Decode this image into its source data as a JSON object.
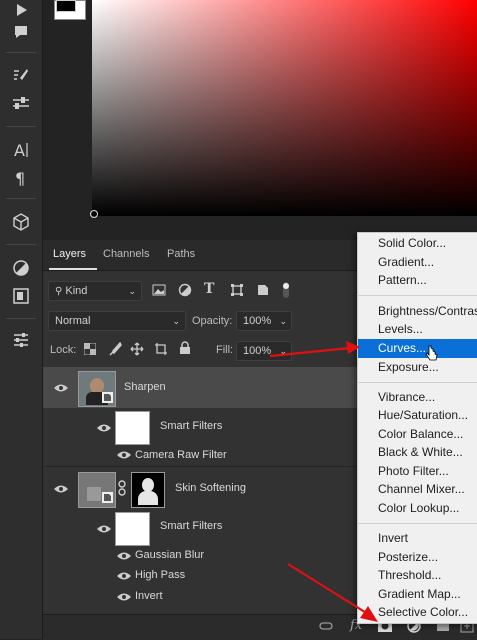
{
  "colors": {
    "accent": "#0a6fd6",
    "arrow": "#e01010"
  },
  "toolbar": {
    "icons": [
      "play-icon",
      "comment-icon",
      "brush-settings-icon",
      "sliders-icon",
      "type-icon",
      "paragraph-icon",
      "cube-icon",
      "adjustment-icon",
      "frame-icon",
      "properties-icon"
    ]
  },
  "tabs": {
    "layers": "Layers",
    "channels": "Channels",
    "paths": "Paths"
  },
  "filter": {
    "kind": "Kind"
  },
  "blend": {
    "mode": "Normal",
    "opacity_label": "Opacity:",
    "opacity_value": "100%"
  },
  "lock": {
    "label": "Lock:",
    "fill_label": "Fill:",
    "fill_value": "100%"
  },
  "layers": [
    {
      "name": "Sharpen",
      "smart_filters": "Smart Filters",
      "filters": [
        "Camera Raw Filter"
      ]
    },
    {
      "name": "Skin Softening",
      "smart_filters": "Smart Filters",
      "filters": [
        "Gaussian Blur",
        "High Pass",
        "Invert"
      ]
    }
  ],
  "menu": {
    "group1": [
      "Solid Color...",
      "Gradient...",
      "Pattern..."
    ],
    "group2": [
      "Brightness/Contrast...",
      "Levels...",
      "Curves...",
      "Exposure..."
    ],
    "group3": [
      "Vibrance...",
      "Hue/Saturation...",
      "Color Balance...",
      "Black & White...",
      "Photo Filter...",
      "Channel Mixer...",
      "Color Lookup..."
    ],
    "group4": [
      "Invert",
      "Posterize...",
      "Threshold...",
      "Gradient Map...",
      "Selective Color..."
    ],
    "highlighted": "Curves..."
  },
  "bottombar": {
    "fx": "fx"
  }
}
